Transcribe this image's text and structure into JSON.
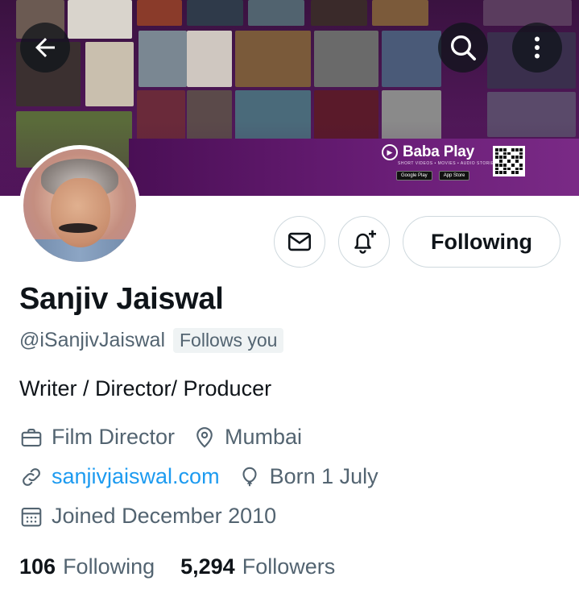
{
  "banner": {
    "brand": "Baba Play",
    "tagline": "SHORT VIDEOS • MOVIES • AUDIO STORIES",
    "stores": [
      "Google Play",
      "App Store"
    ],
    "colors": {
      "background": "#4d1755",
      "accent": "#7a2a86"
    }
  },
  "header": {
    "back_icon": "arrow-left-icon",
    "search_icon": "search-icon",
    "more_icon": "more-vertical-icon"
  },
  "profile": {
    "name": "Sanjiv Jaiswal",
    "handle": "@iSanjivJaiswal",
    "follows_you": "Follows you",
    "bio": "Writer / Director/ Producer",
    "category": "Film Director",
    "location": "Mumbai",
    "website": "sanjivjaiswal.com",
    "birthday": "Born 1 July",
    "joined": "Joined December 2010"
  },
  "actions": {
    "message_icon": "mail-icon",
    "notify_icon": "bell-plus-icon",
    "following_label": "Following"
  },
  "stats": {
    "following_count": "106",
    "following_label": "Following",
    "followers_count": "5,294",
    "followers_label": "Followers"
  },
  "colors": {
    "text_primary": "#0f1419",
    "text_secondary": "#536471",
    "link": "#1d9bf0",
    "border": "#cfd9de"
  }
}
